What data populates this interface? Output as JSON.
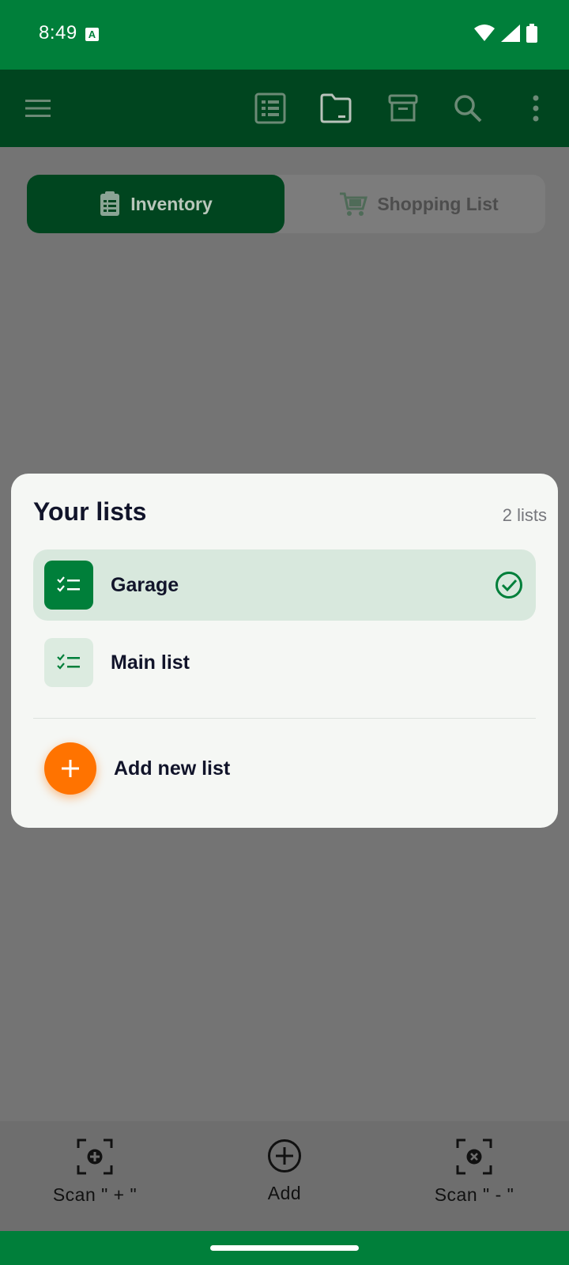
{
  "status_bar": {
    "time": "8:49",
    "notification_letter": "A"
  },
  "toolbar": {
    "icons": [
      "menu-icon",
      "list-view-icon",
      "folder-icon",
      "archive-icon",
      "search-icon",
      "more-vert-icon"
    ]
  },
  "tabs": [
    {
      "label": "Inventory",
      "icon": "clipboard-list-icon",
      "active": true
    },
    {
      "label": "Shopping List",
      "icon": "cart-icon",
      "active": false
    }
  ],
  "sheet": {
    "title": "Your lists",
    "count": "2 lists",
    "lists": [
      {
        "label": "Garage",
        "selected": true
      },
      {
        "label": "Main list",
        "selected": false
      }
    ],
    "add_label": "Add new list"
  },
  "bottom_bar": {
    "scan_plus": "Scan \" + \"",
    "add": "Add",
    "scan_minus": "Scan \" - \""
  },
  "colors": {
    "primary": "#007f3a",
    "primary_dark": "#00451f",
    "accent": "#ff7300",
    "scrim": "#747474"
  }
}
